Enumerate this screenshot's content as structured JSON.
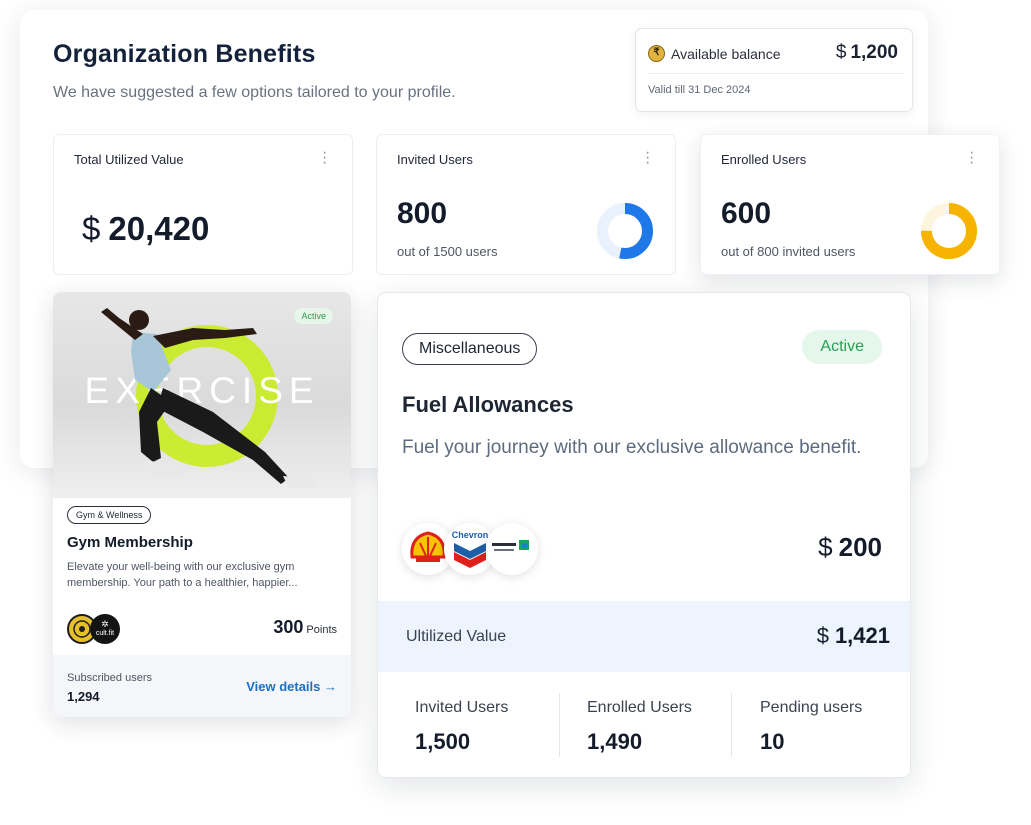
{
  "header": {
    "title": "Organization Benefits",
    "subtitle": "We have suggested a few options tailored to your profile."
  },
  "balance": {
    "icon": "rupee-coin-icon",
    "label": "Available balance",
    "currency": "$",
    "amount": "1,200",
    "valid": "Valid till 31 Dec 2024"
  },
  "stats": {
    "total": {
      "label": "Total Utilized Value",
      "currency": "$",
      "value": "20,420"
    },
    "invited": {
      "label": "Invited Users",
      "value": "800",
      "sub": "out of 1500 users",
      "progress": 0.533,
      "color": "#1f78e8",
      "track": "#e9f1fc"
    },
    "enrolled": {
      "label": "Enrolled Users",
      "value": "600",
      "sub": "out of 800 invited users",
      "progress": 0.75,
      "color": "#f6b400",
      "track": "#fdf5dd"
    }
  },
  "gym": {
    "image_text": "EXERCISE",
    "status": "Active",
    "tag": "Gym & Wellness",
    "title": "Gym Membership",
    "description": "Elevate your well-being with our exclusive gym membership. Your path to a healthier, happier...",
    "logo2_text": "cult.fit",
    "points": "300",
    "points_unit": "Points",
    "subscribed_label": "Subscribed users",
    "subscribed_value": "1,294",
    "link": "View details →"
  },
  "fuel": {
    "category": "Miscellaneous",
    "status": "Active",
    "title": "Fuel Allowances",
    "description": "Fuel your journey with our exclusive allowance benefit.",
    "brands": {
      "shell": "shell-logo",
      "chevron": "Chevron",
      "aramco": "aramco-logo"
    },
    "currency": "$",
    "amount": "200",
    "utilized_label": "Ultilized Value",
    "utilized_value": "1,421",
    "invited_label": "Invited Users",
    "invited_value": "1,500",
    "enrolled_label": "Enrolled Users",
    "enrolled_value": "1,490",
    "pending_label": "Pending users",
    "pending_value": "10"
  }
}
